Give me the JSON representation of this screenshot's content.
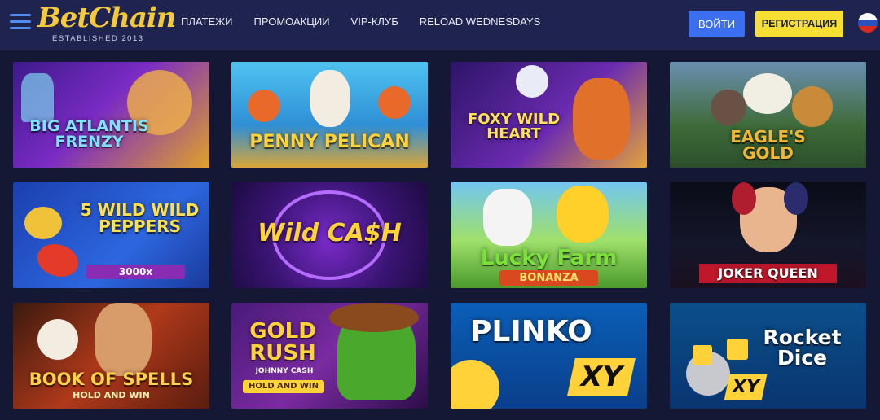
{
  "header": {
    "logo_text": "BetChain",
    "logo_subtitle": "ESTABLISHED 2013",
    "nav": [
      "ПЛАТЕЖИ",
      "ПРОМОАКЦИИ",
      "VIP-КЛУБ",
      "RELOAD WEDNESDAYS"
    ],
    "login_label": "ВОЙТИ",
    "register_label": "РЕГИСТРАЦИЯ",
    "language_icon": "russian-flag-icon"
  },
  "colors": {
    "header_bg": "#1f2350",
    "page_bg": "#141834",
    "login_button": "#3b6ff0",
    "register_button": "#f6de33",
    "logo": "#f5c93a"
  },
  "games": [
    {
      "title": "BIG ATLANTIS FRENZY"
    },
    {
      "title": "PENNY PELICAN"
    },
    {
      "title": "FOXY WILD HEART"
    },
    {
      "title": "EAGLE'S GOLD"
    },
    {
      "title": "5 WILD WILD PEPPERS",
      "badge": "3000x"
    },
    {
      "title": "Wild CA$H"
    },
    {
      "title": "Lucky Farm",
      "badge": "BONANZA"
    },
    {
      "title": "JOKER QUEEN"
    },
    {
      "title": "BOOK OF SPELLS",
      "badge": "HOLD AND WIN"
    },
    {
      "title": "GOLD RUSH",
      "subtitle": "JOHNNY CASH",
      "badge": "HOLD AND WIN"
    },
    {
      "title": "PLINKO",
      "badge": "XY"
    },
    {
      "title": "Rocket Dice",
      "badge": "XY"
    }
  ]
}
